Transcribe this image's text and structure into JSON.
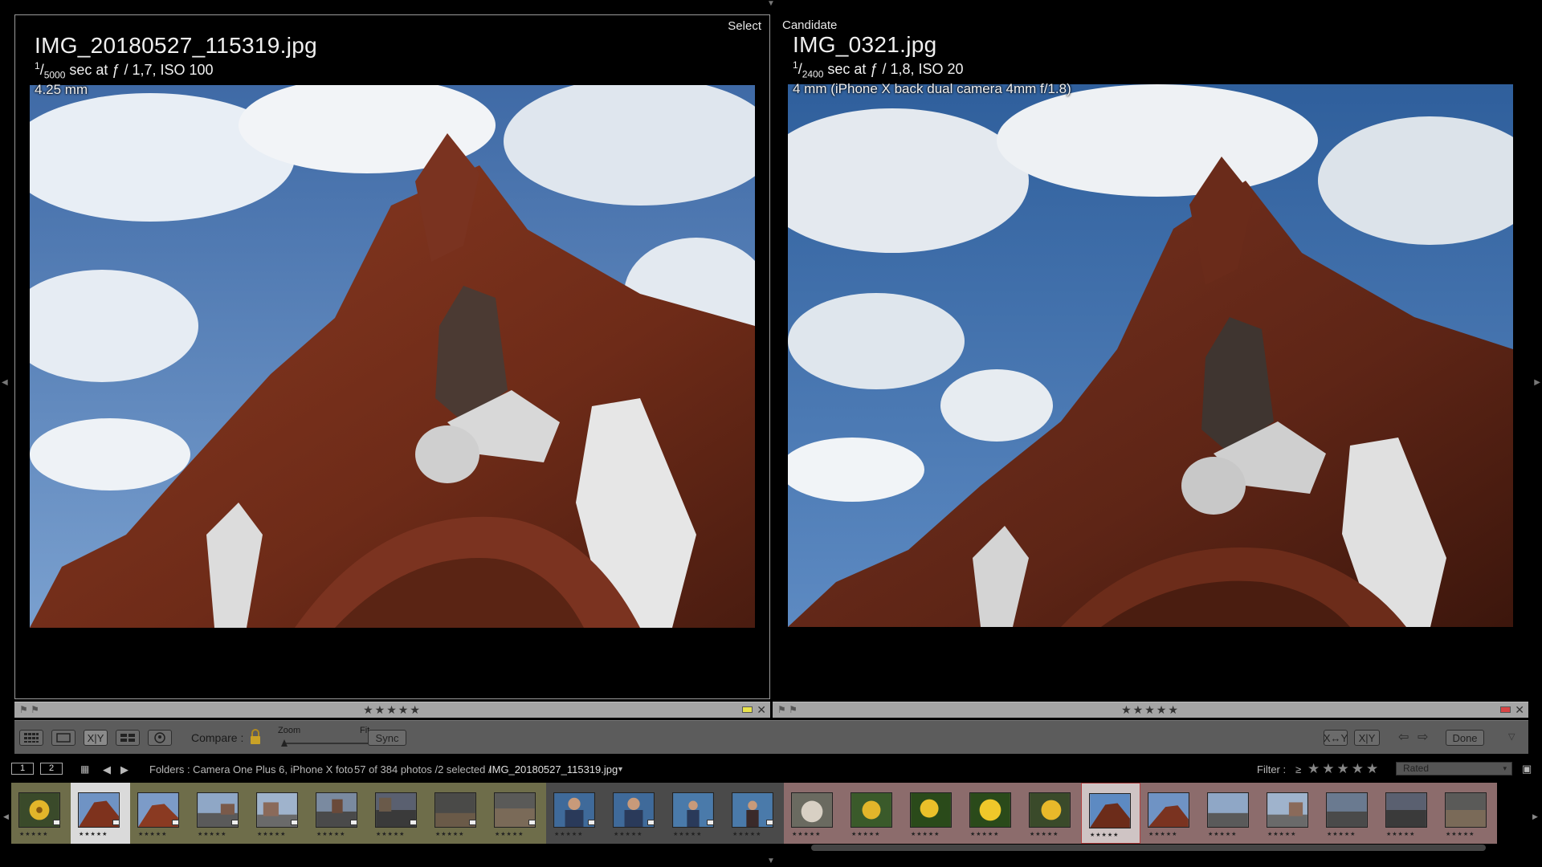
{
  "select_pane": {
    "tag": "Select",
    "filename": "IMG_20180527_115319.jpg",
    "shutter_num": "1",
    "shutter_den": "5000",
    "exposure_rest": " sec at ƒ / 1,7, ISO 100",
    "focal": "4.25 mm",
    "rating": "★★★★★"
  },
  "candidate_pane": {
    "tag": "Candidate",
    "filename": "IMG_0321.jpg",
    "shutter_num": "1",
    "shutter_den": "2400",
    "exposure_rest": " sec at ƒ / 1,8, ISO 20",
    "focal": "4 mm (iPhone X back dual camera 4mm f/1.8)",
    "rating": "★★★★★"
  },
  "toolbar": {
    "compare_label": "Compare :",
    "zoom_label": "Zoom",
    "fit_label": "Fit",
    "sync_label": "Sync",
    "xy_label": "X|Y",
    "swap_label": "X↔Y",
    "make_select_label": "X|Y",
    "done_label": "Done"
  },
  "info_bar": {
    "page1": "1",
    "page2": "2",
    "source": "Folders : Camera One Plus 6, iPhone X foto",
    "count": "57 of 384 photos /2 selected /",
    "current_file": "IMG_20180527_115319.jpg",
    "filter_label": "Filter :",
    "filter_op": "≥",
    "filter_stars": "★★★★★",
    "filter_preset": "Rated"
  },
  "filmstrip": {
    "thumb_stars": "★★★★★"
  },
  "colors": {
    "background": "#000000",
    "chrome": "#5c5c5c",
    "footer_strip": "#a5a5a5",
    "label_yellow": "#e8e24a",
    "label_red": "#d84444"
  }
}
